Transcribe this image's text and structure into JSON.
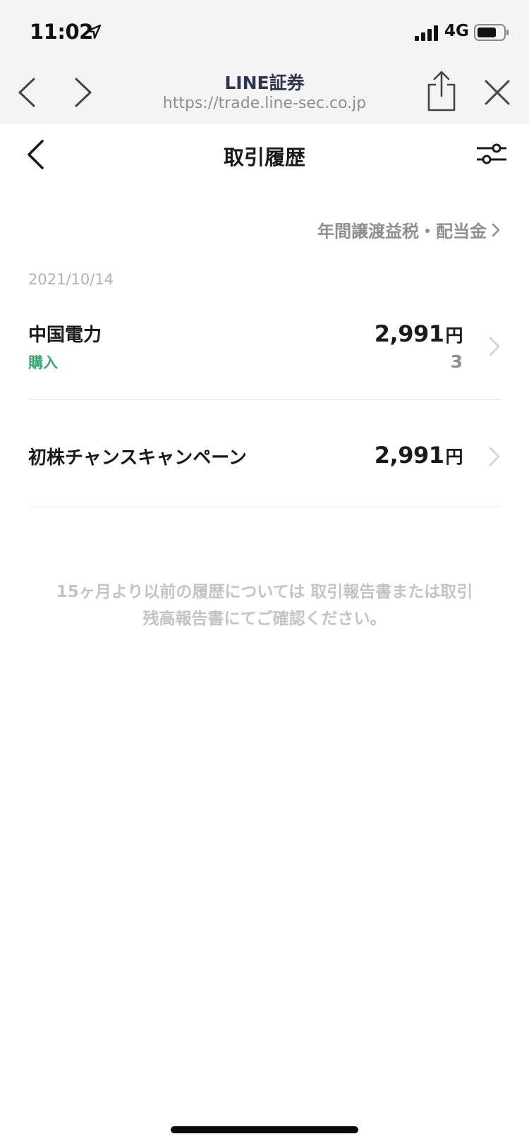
{
  "status_bar": {
    "time": "11:02",
    "network": "4G"
  },
  "browser": {
    "site_title": "LINE証券",
    "url": "https://trade.line-sec.co.jp"
  },
  "page": {
    "title": "取引履歴",
    "annual_link_label": "年間譲渡益税・配当金",
    "date": "2021/10/14",
    "transactions": [
      {
        "name": "中国電力",
        "type": "購入",
        "amount": "2,991",
        "currency": "円",
        "quantity": "3"
      },
      {
        "name": "初株チャンスキャンペーン",
        "amount": "2,991",
        "currency": "円"
      }
    ],
    "notice_line1": "15ヶ月より以前の履歴については 取引報告書または取引",
    "notice_line2": "残高報告書にてご確認ください。"
  },
  "colors": {
    "chrome_bg": "#f4f4f4",
    "accent_green": "#3aa873",
    "muted_gray": "#8e8e93",
    "text_dark": "#1a1a1a"
  },
  "icons": [
    "location-arrow-icon",
    "signal-icon",
    "battery-icon",
    "back-icon",
    "forward-icon",
    "share-icon",
    "close-icon",
    "filter-icon",
    "chevron-right-icon"
  ]
}
